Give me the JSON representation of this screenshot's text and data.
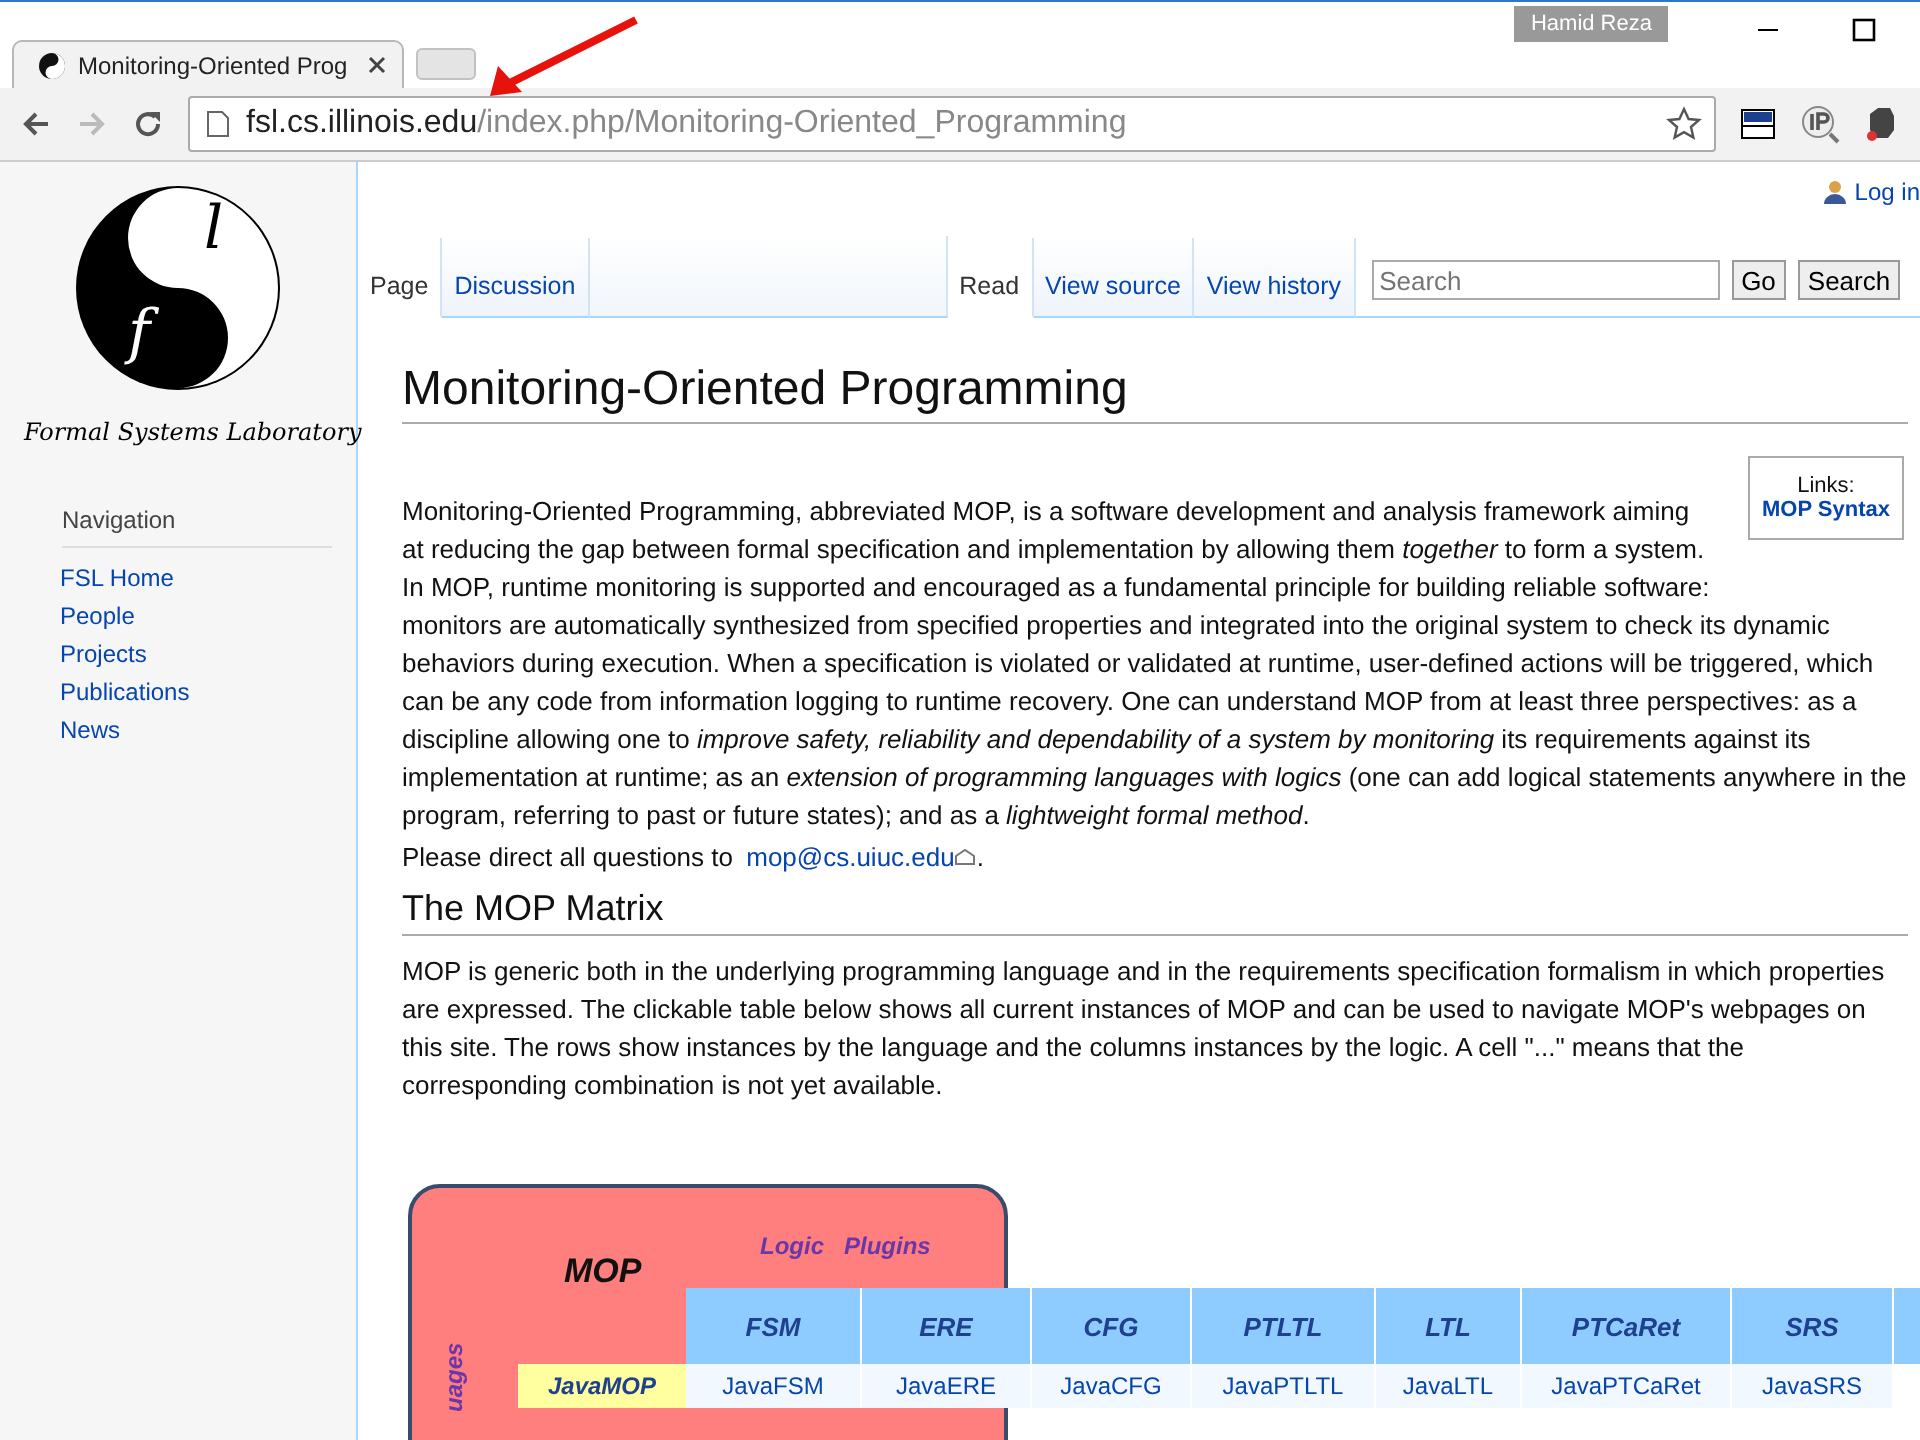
{
  "browser": {
    "profile": "Hamid Reza",
    "tab_title": "Monitoring-Oriented Prog",
    "url_host": "fsl.cs.illinois.edu",
    "url_path": "/index.php/Monitoring-Oriented_Programming"
  },
  "sidebar": {
    "logo_letters": [
      "l",
      "f"
    ],
    "logo_caption": "Formal Systems Laboratory",
    "nav_heading": "Navigation",
    "items": [
      "FSL Home",
      "People",
      "Projects",
      "Publications",
      "News"
    ]
  },
  "user_link": "Log in",
  "left_tabs": [
    {
      "label": "Page",
      "selected": true
    },
    {
      "label": "Discussion",
      "selected": false
    }
  ],
  "right_tabs": [
    {
      "label": "Read",
      "selected": true
    },
    {
      "label": "View source",
      "selected": false
    },
    {
      "label": "View history",
      "selected": false
    }
  ],
  "search": {
    "placeholder": "Search",
    "buttons": [
      "Go",
      "Search"
    ]
  },
  "title": "Monitoring-Oriented Programming",
  "links_box": {
    "heading": "Links:",
    "link": "MOP Syntax"
  },
  "intro": [
    "Monitoring-Oriented Programming, abbreviated MOP, is a software development and analysis framework aiming at reducing the gap between formal specification and implementation by allowing them *together* to form a system. In MOP, runtime monitoring is supported and encouraged as a fundamental principle for building reliable software:",
    "monitors are automatically synthesized from specified properties and integrated into the original system to check its dynamic behaviors during execution. When a specification is violated or validated at runtime, user-defined actions will be triggered, which can be any code from information logging to runtime recovery. One can understand MOP from at least three perspectives: as a discipline allowing one to *improve safety, reliability and dependability of a system by monitoring* its requirements against its implementation at runtime; as an *extension of programming languages with logics* (one can add logical statements anywhere in the program, referring to past or future states); and as a *lightweight formal method*."
  ],
  "contact": {
    "text": "Please direct all questions to",
    "email": "mop@cs.uiuc.edu",
    "end": "."
  },
  "section_heading": "The MOP Matrix",
  "section_text": "MOP is generic both in the underlying programming language and in the requirements specification formalism in which properties are expressed. The clickable table below shows all current instances of MOP and can be used to navigate MOP's webpages on this site. The rows show instances by the language and the columns instances by the logic. A cell \"...\" means that the corresponding combination is not yet available.",
  "matrix": {
    "title": "MOP",
    "logic_label": "Logic   Plugins",
    "language_label": "uages",
    "columns": [
      "FSM",
      "ERE",
      "CFG",
      "PTLTL",
      "LTL",
      "PTCaRet",
      "SRS"
    ],
    "rows": [
      {
        "name": "JavaMOP",
        "cells": [
          "JavaFSM",
          "JavaERE",
          "JavaCFG",
          "JavaPTLTL",
          "JavaLTL",
          "JavaPTCaRet",
          "JavaSRS"
        ]
      }
    ]
  }
}
